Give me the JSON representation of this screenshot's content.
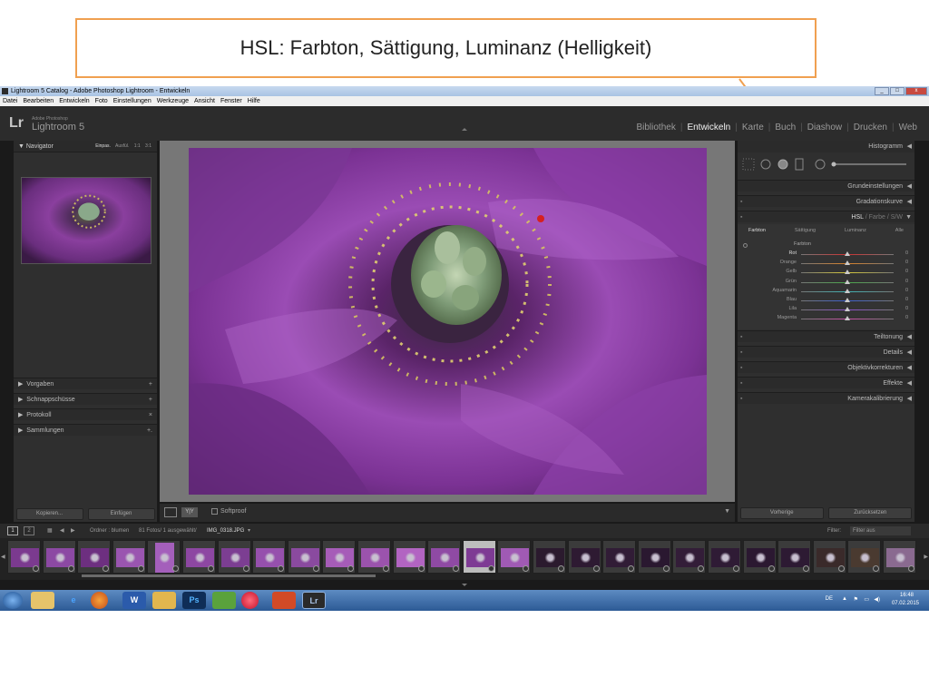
{
  "callout": {
    "text": "HSL: Farbton, Sättigung, Luminanz (Helligkeit)"
  },
  "window": {
    "title": "Lightroom 5 Catalog - Adobe Photoshop Lightroom - Entwickeln",
    "controls": [
      "_",
      "□",
      "x"
    ]
  },
  "menu": [
    "Datei",
    "Bearbeiten",
    "Entwickeln",
    "Foto",
    "Einstellungen",
    "Werkzeuge",
    "Ansicht",
    "Fenster",
    "Hilfe"
  ],
  "brand": {
    "logo": "Lr",
    "adobe": "Adobe Photoshop",
    "product": "Lightroom 5"
  },
  "modules": [
    "Bibliothek",
    "Entwickeln",
    "Karte",
    "Buch",
    "Diashow",
    "Drucken",
    "Web"
  ],
  "left_panel": {
    "navigator": "Navigator",
    "nav_options": [
      "Einpas.",
      "Ausfül.",
      "1:1",
      "3:1"
    ],
    "sections": [
      {
        "label": "Vorgaben",
        "action": "+"
      },
      {
        "label": "Schnappschüsse",
        "action": "+"
      },
      {
        "label": "Protokoll",
        "action": "×"
      },
      {
        "label": "Sammlungen",
        "action": "+."
      }
    ],
    "copy_button": "Kopieren...",
    "paste_button": "Einfügen"
  },
  "toolbar": {
    "softproof": "Softproof",
    "yy": "Y|Y"
  },
  "right_panel": {
    "histogram": "Histogramm",
    "sections_top": [
      "Grundeinstellungen",
      "Gradationskurve"
    ],
    "hsl_header": {
      "hsl": "HSL",
      "sep1": "/",
      "farbe": "Farbe",
      "sep2": "/",
      "sw": "S/W"
    },
    "hsl_tabs": [
      "Farbton",
      "Sättigung",
      "Luminanz",
      "Alle"
    ],
    "hsl_group": "Farbton",
    "hsl_rows": [
      {
        "label": "Rot",
        "value": "0",
        "color": "#cc3333"
      },
      {
        "label": "Orange",
        "value": "0",
        "color": "#d9822b"
      },
      {
        "label": "Gelb",
        "value": "0",
        "color": "#d6c93a"
      },
      {
        "label": "Grün",
        "value": "0",
        "color": "#4aa84a"
      },
      {
        "label": "Aquamarin",
        "value": "0",
        "color": "#3fb3b3"
      },
      {
        "label": "Blau",
        "value": "0",
        "color": "#3a5fd1"
      },
      {
        "label": "Lila",
        "value": "0",
        "color": "#8a4fc9"
      },
      {
        "label": "Magenta",
        "value": "0",
        "color": "#c94fa6"
      }
    ],
    "sections_bottom": [
      "Teiltonung",
      "Details",
      "Objektivkorrekturen",
      "Effekte",
      "Kamerakalibrierung"
    ],
    "prev_button": "Vorherige",
    "reset_button": "Zurücksetzen"
  },
  "filmstrip": {
    "page1": "1",
    "page2": "2",
    "path": "Ordner : blumen",
    "count": "81 Fotos/ 1 ausgewählt/",
    "filename": "IMG_0318.JPG",
    "filter_label": "Filter:",
    "filter_value": "Filter aus"
  },
  "taskbar": {
    "lang": "DE",
    "time": "16:48",
    "date": "07.02.2015",
    "apps": [
      "start",
      "explorer",
      "ie",
      "firefox",
      "word",
      "folder",
      "photoshop",
      "app-green",
      "itunes",
      "powerpoint",
      "lightroom"
    ]
  }
}
